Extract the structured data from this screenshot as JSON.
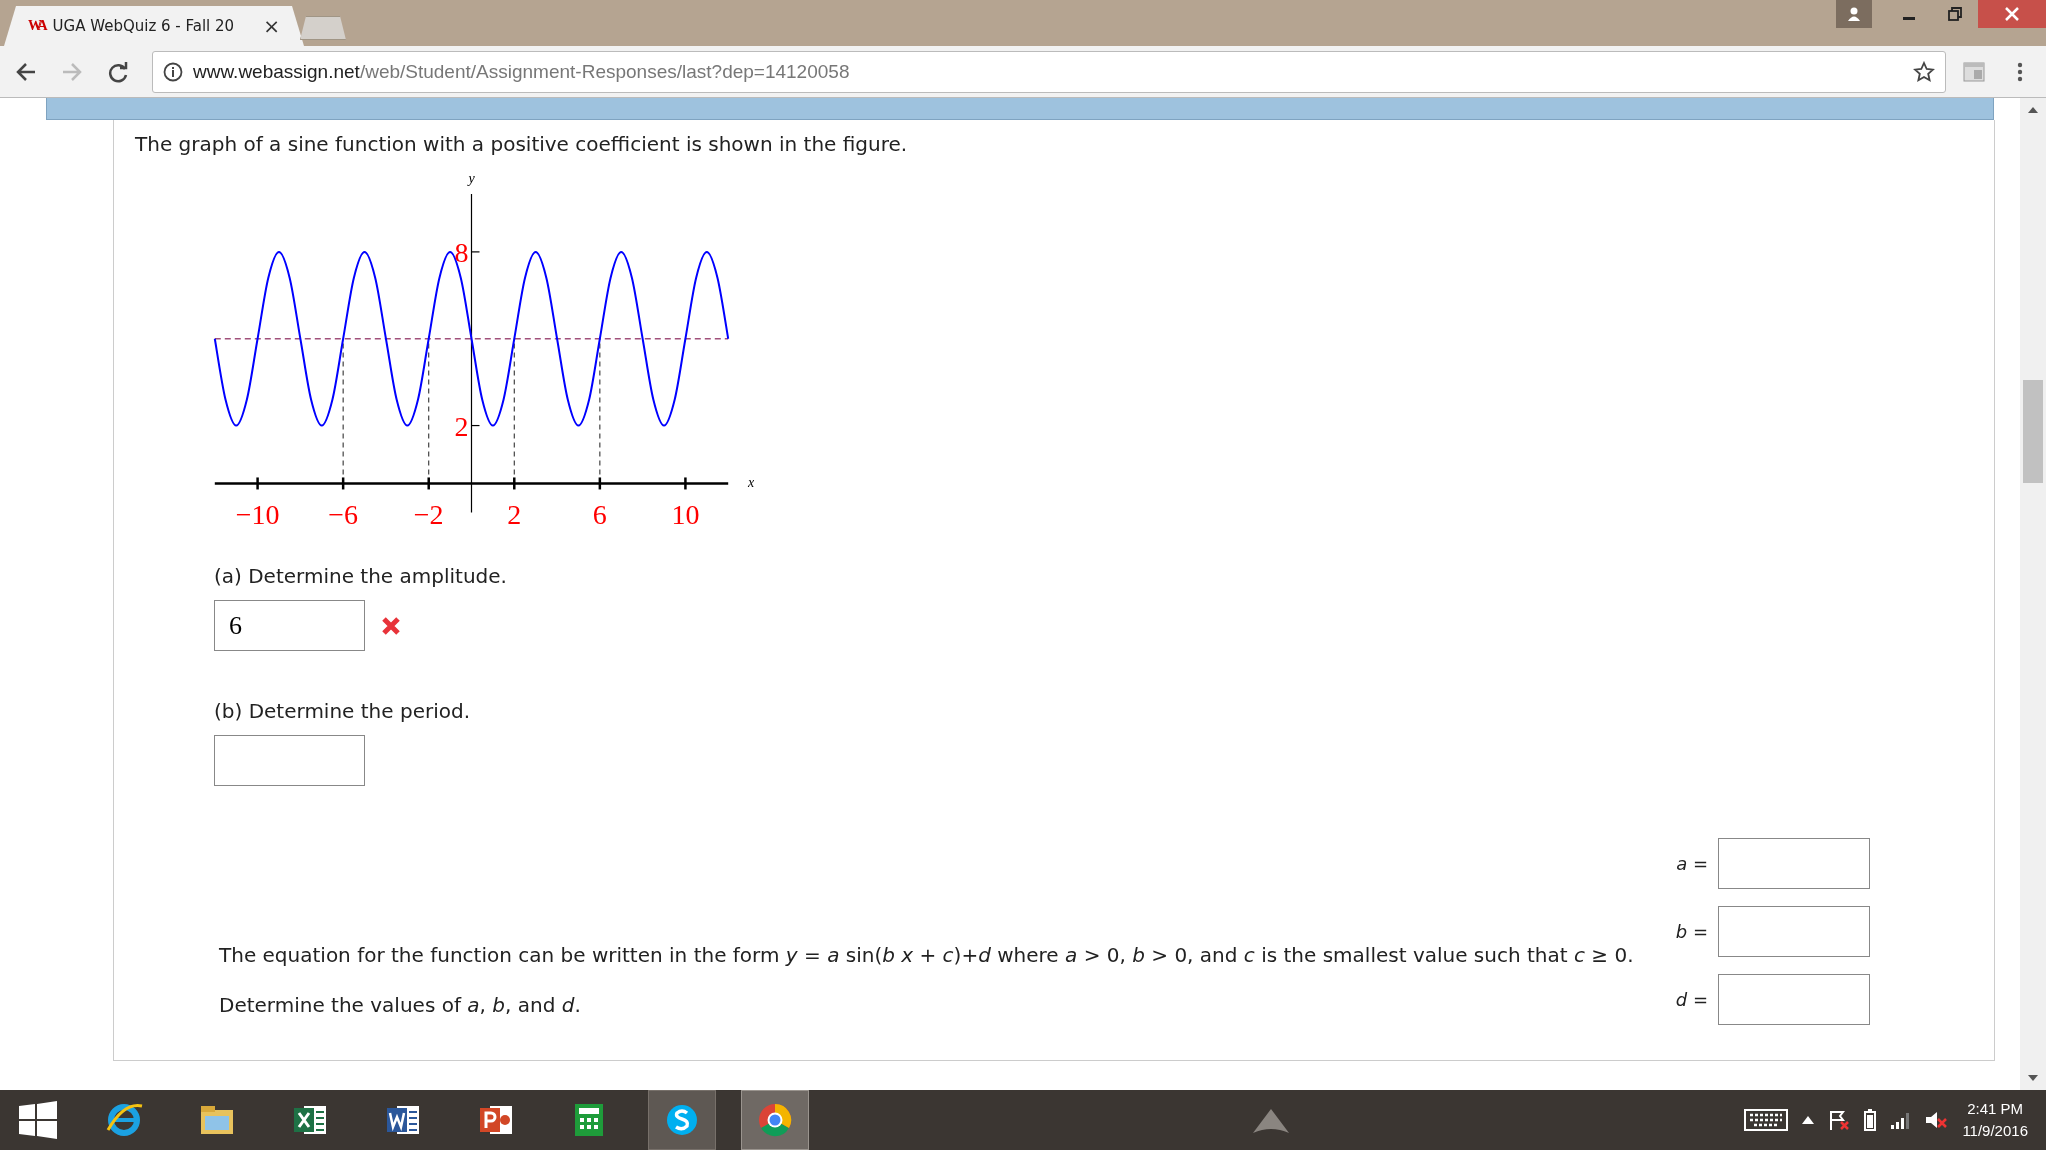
{
  "browser": {
    "tab": {
      "icon_text": "WA",
      "title": "UGA WebQuiz 6 - Fall 20",
      "close": "×"
    },
    "address": {
      "domain": "www.webassign.net",
      "path": "/web/Student/Assignment-Responses/last?dep=14120058"
    },
    "forward_disabled": true
  },
  "question": {
    "prompt": "The graph of a sine function with a positive coefficient is shown in the figure.",
    "chart_data": {
      "type": "line",
      "xlabel": "x",
      "ylabel": "y",
      "x": [
        -12,
        -11.5,
        -11,
        -10.5,
        -10,
        -9.5,
        -9,
        -8.5,
        -8,
        -7.5,
        -7,
        -6.5,
        -6,
        -5.5,
        -5,
        -4.5,
        -4,
        -3.5,
        -3,
        -2.5,
        -2,
        -1.5,
        -1,
        -0.5,
        0,
        0.5,
        1,
        1.5,
        2,
        2.5,
        3,
        3.5,
        4,
        4.5,
        5,
        5.5,
        6,
        6.5,
        7,
        7.5,
        8,
        8.5,
        9,
        9.5,
        10,
        10.5,
        11,
        11.5,
        12
      ],
      "series": [
        {
          "color": "#0000ff",
          "values": [
            5,
            2.9,
            2,
            2.9,
            5,
            7.1,
            8,
            7.1,
            5,
            2.9,
            2,
            2.9,
            5,
            7.1,
            8,
            7.1,
            5,
            2.9,
            2,
            2.9,
            5,
            7.1,
            8,
            7.1,
            5,
            2.9,
            2,
            2.9,
            5,
            7.1,
            8,
            7.1,
            5,
            2.9,
            2,
            2.9,
            5,
            7.1,
            8,
            7.1,
            5,
            2.9,
            2,
            2.9,
            5,
            7.1,
            8,
            7.1,
            5
          ]
        }
      ],
      "xlim": [
        -12,
        12
      ],
      "ylim": [
        -1,
        10
      ],
      "xticks": [
        {
          "value": -10,
          "label": "−10"
        },
        {
          "value": -6,
          "label": "−6"
        },
        {
          "value": -2,
          "label": "−2"
        },
        {
          "value": 2,
          "label": "2"
        },
        {
          "value": 6,
          "label": "6"
        },
        {
          "value": 10,
          "label": "10"
        }
      ],
      "yticks": [
        2,
        8
      ],
      "ref_lines": [
        {
          "axis": "y",
          "value": 5
        },
        {
          "axis": "x",
          "value": -6
        },
        {
          "axis": "x",
          "value": -2
        },
        {
          "axis": "x",
          "value": 2
        },
        {
          "axis": "x",
          "value": 6
        }
      ]
    },
    "parts": [
      {
        "label": "(a) Determine the amplitude.",
        "value": "6",
        "incorrect": true
      },
      {
        "label": "(b) Determine the period."
      }
    ],
    "equation": {
      "text": "The equation for the function can be written in the form *y* = *a* sin(*b* *x* + *c*)+*d* where *a* > 0, *b* > 0, and *c* is the smallest value such that *c* ≥ 0.",
      "instruction": "Determine the values of *a*, *b*, and *d*.",
      "fields": [
        {
          "label": "*a* ="
        },
        {
          "label": "*b* ="
        },
        {
          "label": "*d* ="
        }
      ]
    }
  },
  "taskbar": {
    "apps": [
      {
        "kind": "ie",
        "open": false,
        "selected": false
      },
      {
        "kind": "explorer",
        "open": false,
        "selected": false
      },
      {
        "kind": "excel",
        "open": false,
        "selected": false
      },
      {
        "kind": "word",
        "open": false,
        "selected": false
      },
      {
        "kind": "powerpoint",
        "open": false,
        "selected": false
      },
      {
        "kind": "calculator",
        "open": false,
        "selected": false
      },
      {
        "kind": "skype",
        "open": true,
        "selected": false
      },
      {
        "kind": "chrome",
        "open": true,
        "selected": true
      }
    ],
    "time": "2:41 PM",
    "date": "11/9/2016"
  }
}
